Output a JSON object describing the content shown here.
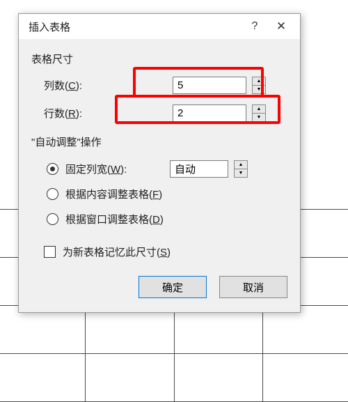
{
  "dialog": {
    "title": "插入表格",
    "help_tooltip": "帮助",
    "close_tooltip": "关闭",
    "size_section": "表格尺寸",
    "columns_label_pre": "列数(",
    "columns_label_u": "C",
    "columns_label_post": "):",
    "columns_value": "5",
    "rows_label_pre": "行数(",
    "rows_label_u": "R",
    "rows_label_post": "):",
    "rows_value": "2",
    "autofit_section": "\"自动调整\"操作",
    "opt_fixed_pre": "固定列宽(",
    "opt_fixed_u": "W",
    "opt_fixed_post": "):",
    "fixed_width_value": "自动",
    "opt_content_pre": "根据内容调整表格(",
    "opt_content_u": "F",
    "opt_content_post": ")",
    "opt_window_pre": "根据窗口调整表格(",
    "opt_window_u": "D",
    "opt_window_post": ")",
    "remember_pre": "为新表格记忆此尺寸(",
    "remember_u": "S",
    "remember_post": ")",
    "ok": "确定",
    "cancel": "取消"
  }
}
